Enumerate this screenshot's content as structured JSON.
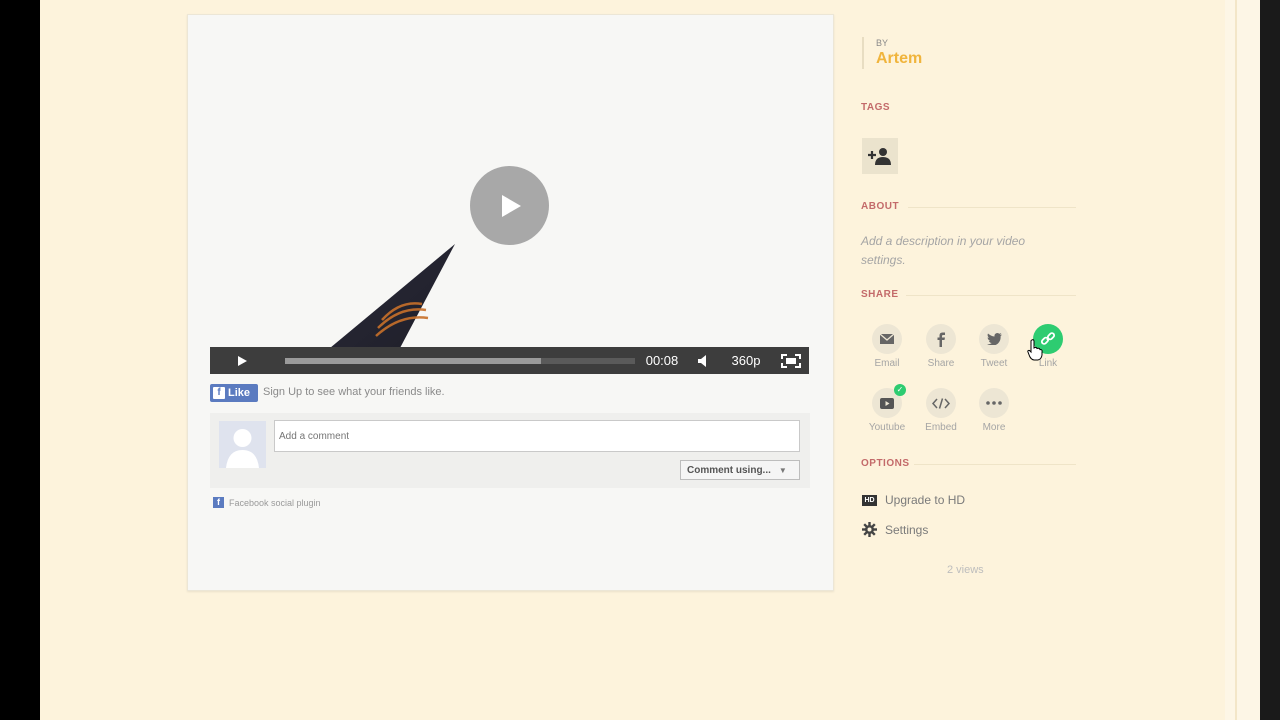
{
  "video": {
    "time": "00:08",
    "quality": "360p",
    "progress_fraction": 0.73
  },
  "facebook": {
    "like_label": "Like",
    "like_fb_glyph": "f",
    "like_text": "Sign Up to see what your friends like.",
    "comment_placeholder": "Add a comment",
    "comment_using_label": "Comment using...",
    "plugin_label": "Facebook social plugin",
    "plugin_glyph": "f"
  },
  "sidebar": {
    "by_label": "BY",
    "author": "Artem",
    "tags_title": "TAGS",
    "about_title": "ABOUT",
    "about_text": "Add a description in your video settings.",
    "share_title": "SHARE",
    "share_items": [
      {
        "label": "Email",
        "icon": "email-icon"
      },
      {
        "label": "Share",
        "icon": "facebook-icon"
      },
      {
        "label": "Tweet",
        "icon": "twitter-icon"
      },
      {
        "label": "Link",
        "icon": "link-icon"
      },
      {
        "label": "Youtube",
        "icon": "youtube-icon"
      },
      {
        "label": "Embed",
        "icon": "embed-icon"
      },
      {
        "label": "More",
        "icon": "more-icon"
      }
    ],
    "options_title": "OPTIONS",
    "hd_badge": "HD",
    "upgrade_label": "Upgrade to HD",
    "settings_label": "Settings",
    "views": "2 views"
  },
  "colors": {
    "page_bg": "#fdf3dc",
    "accent_author": "#f0b43c",
    "section_title": "#c36a6a",
    "link_active": "#2ecc71",
    "facebook_blue": "#5b7bc0"
  }
}
